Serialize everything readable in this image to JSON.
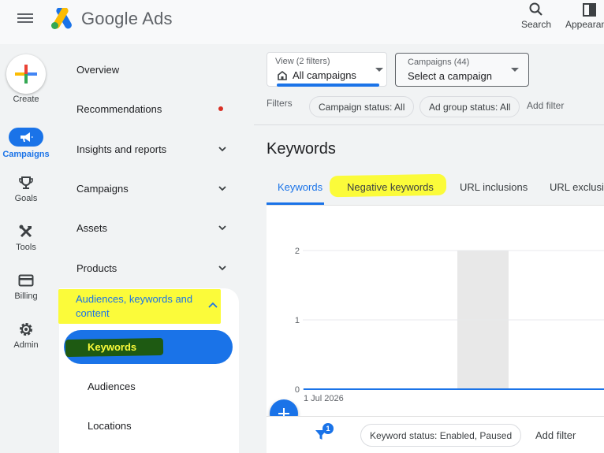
{
  "app": {
    "brand": "Google Ads"
  },
  "topbar": {
    "search_label": "Search",
    "appearance_label": "Appearan"
  },
  "rail": {
    "create_label": "Create",
    "items": [
      {
        "label": "Campaigns",
        "icon": "campaigns-megaphone-icon",
        "active": true
      },
      {
        "label": "Goals",
        "icon": "trophy-icon"
      },
      {
        "label": "Tools",
        "icon": "tools-icon"
      },
      {
        "label": "Billing",
        "icon": "credit-card-icon"
      },
      {
        "label": "Admin",
        "icon": "gear-icon"
      }
    ]
  },
  "nav": {
    "items": [
      {
        "label": "Overview"
      },
      {
        "label": "Recommendations",
        "has_dot": true
      },
      {
        "label": "Insights and reports",
        "expandable": true
      },
      {
        "label": "Campaigns",
        "expandable": true
      },
      {
        "label": "Assets",
        "expandable": true
      },
      {
        "label": "Products",
        "expandable": true
      }
    ],
    "expanded_section": "Audiences, keywords and content",
    "sub_items": [
      {
        "label": "Keywords",
        "active": true
      },
      {
        "label": "Audiences"
      },
      {
        "label": "Locations"
      }
    ]
  },
  "toolbar": {
    "view_small": "View (2 filters)",
    "view_value": "All campaigns",
    "campaigns_small": "Campaigns (44)",
    "campaigns_value": "Select a campaign",
    "filters_label": "Filters",
    "chips": [
      "Campaign status: All",
      "Ad group status: All"
    ],
    "add_filter": "Add filter"
  },
  "page": {
    "title": "Keywords",
    "tabs": [
      {
        "label": "Keywords",
        "active": true
      },
      {
        "label": "Negative keywords",
        "highlighted": true
      },
      {
        "label": "URL inclusions"
      },
      {
        "label": "URL exclusi"
      }
    ]
  },
  "chart_data": {
    "type": "line",
    "x": [
      "1 Jul 2026"
    ],
    "series": [
      {
        "values": [
          0
        ]
      }
    ],
    "yticks": [
      "2",
      "1",
      "0"
    ],
    "ylim": [
      0,
      2
    ],
    "grid": true
  },
  "bottom_bar": {
    "filter_badge": "1",
    "status_chip": "Keyword status: Enabled, Paused",
    "add_filter": "Add filter"
  },
  "colors": {
    "accent": "#1a73e8",
    "highlight": "#fbfb3a",
    "dark_mark": "#1e5a12"
  }
}
